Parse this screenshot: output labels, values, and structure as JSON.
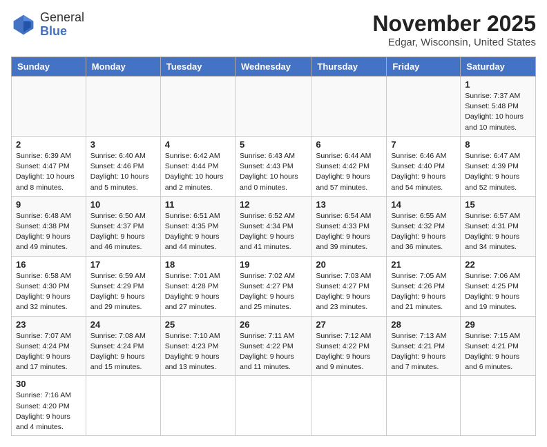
{
  "logo": {
    "line1": "General",
    "line2": "Blue"
  },
  "title": "November 2025",
  "location": "Edgar, Wisconsin, United States",
  "weekdays": [
    "Sunday",
    "Monday",
    "Tuesday",
    "Wednesday",
    "Thursday",
    "Friday",
    "Saturday"
  ],
  "weeks": [
    [
      {
        "day": "",
        "info": ""
      },
      {
        "day": "",
        "info": ""
      },
      {
        "day": "",
        "info": ""
      },
      {
        "day": "",
        "info": ""
      },
      {
        "day": "",
        "info": ""
      },
      {
        "day": "",
        "info": ""
      },
      {
        "day": "1",
        "info": "Sunrise: 7:37 AM\nSunset: 5:48 PM\nDaylight: 10 hours and 10 minutes."
      }
    ],
    [
      {
        "day": "2",
        "info": "Sunrise: 6:39 AM\nSunset: 4:47 PM\nDaylight: 10 hours and 8 minutes."
      },
      {
        "day": "3",
        "info": "Sunrise: 6:40 AM\nSunset: 4:46 PM\nDaylight: 10 hours and 5 minutes."
      },
      {
        "day": "4",
        "info": "Sunrise: 6:42 AM\nSunset: 4:44 PM\nDaylight: 10 hours and 2 minutes."
      },
      {
        "day": "5",
        "info": "Sunrise: 6:43 AM\nSunset: 4:43 PM\nDaylight: 10 hours and 0 minutes."
      },
      {
        "day": "6",
        "info": "Sunrise: 6:44 AM\nSunset: 4:42 PM\nDaylight: 9 hours and 57 minutes."
      },
      {
        "day": "7",
        "info": "Sunrise: 6:46 AM\nSunset: 4:40 PM\nDaylight: 9 hours and 54 minutes."
      },
      {
        "day": "8",
        "info": "Sunrise: 6:47 AM\nSunset: 4:39 PM\nDaylight: 9 hours and 52 minutes."
      }
    ],
    [
      {
        "day": "9",
        "info": "Sunrise: 6:48 AM\nSunset: 4:38 PM\nDaylight: 9 hours and 49 minutes."
      },
      {
        "day": "10",
        "info": "Sunrise: 6:50 AM\nSunset: 4:37 PM\nDaylight: 9 hours and 46 minutes."
      },
      {
        "day": "11",
        "info": "Sunrise: 6:51 AM\nSunset: 4:35 PM\nDaylight: 9 hours and 44 minutes."
      },
      {
        "day": "12",
        "info": "Sunrise: 6:52 AM\nSunset: 4:34 PM\nDaylight: 9 hours and 41 minutes."
      },
      {
        "day": "13",
        "info": "Sunrise: 6:54 AM\nSunset: 4:33 PM\nDaylight: 9 hours and 39 minutes."
      },
      {
        "day": "14",
        "info": "Sunrise: 6:55 AM\nSunset: 4:32 PM\nDaylight: 9 hours and 36 minutes."
      },
      {
        "day": "15",
        "info": "Sunrise: 6:57 AM\nSunset: 4:31 PM\nDaylight: 9 hours and 34 minutes."
      }
    ],
    [
      {
        "day": "16",
        "info": "Sunrise: 6:58 AM\nSunset: 4:30 PM\nDaylight: 9 hours and 32 minutes."
      },
      {
        "day": "17",
        "info": "Sunrise: 6:59 AM\nSunset: 4:29 PM\nDaylight: 9 hours and 29 minutes."
      },
      {
        "day": "18",
        "info": "Sunrise: 7:01 AM\nSunset: 4:28 PM\nDaylight: 9 hours and 27 minutes."
      },
      {
        "day": "19",
        "info": "Sunrise: 7:02 AM\nSunset: 4:27 PM\nDaylight: 9 hours and 25 minutes."
      },
      {
        "day": "20",
        "info": "Sunrise: 7:03 AM\nSunset: 4:27 PM\nDaylight: 9 hours and 23 minutes."
      },
      {
        "day": "21",
        "info": "Sunrise: 7:05 AM\nSunset: 4:26 PM\nDaylight: 9 hours and 21 minutes."
      },
      {
        "day": "22",
        "info": "Sunrise: 7:06 AM\nSunset: 4:25 PM\nDaylight: 9 hours and 19 minutes."
      }
    ],
    [
      {
        "day": "23",
        "info": "Sunrise: 7:07 AM\nSunset: 4:24 PM\nDaylight: 9 hours and 17 minutes."
      },
      {
        "day": "24",
        "info": "Sunrise: 7:08 AM\nSunset: 4:24 PM\nDaylight: 9 hours and 15 minutes."
      },
      {
        "day": "25",
        "info": "Sunrise: 7:10 AM\nSunset: 4:23 PM\nDaylight: 9 hours and 13 minutes."
      },
      {
        "day": "26",
        "info": "Sunrise: 7:11 AM\nSunset: 4:22 PM\nDaylight: 9 hours and 11 minutes."
      },
      {
        "day": "27",
        "info": "Sunrise: 7:12 AM\nSunset: 4:22 PM\nDaylight: 9 hours and 9 minutes."
      },
      {
        "day": "28",
        "info": "Sunrise: 7:13 AM\nSunset: 4:21 PM\nDaylight: 9 hours and 7 minutes."
      },
      {
        "day": "29",
        "info": "Sunrise: 7:15 AM\nSunset: 4:21 PM\nDaylight: 9 hours and 6 minutes."
      }
    ],
    [
      {
        "day": "30",
        "info": "Sunrise: 7:16 AM\nSunset: 4:20 PM\nDaylight: 9 hours and 4 minutes."
      },
      {
        "day": "",
        "info": ""
      },
      {
        "day": "",
        "info": ""
      },
      {
        "day": "",
        "info": ""
      },
      {
        "day": "",
        "info": ""
      },
      {
        "day": "",
        "info": ""
      },
      {
        "day": "",
        "info": ""
      }
    ]
  ]
}
